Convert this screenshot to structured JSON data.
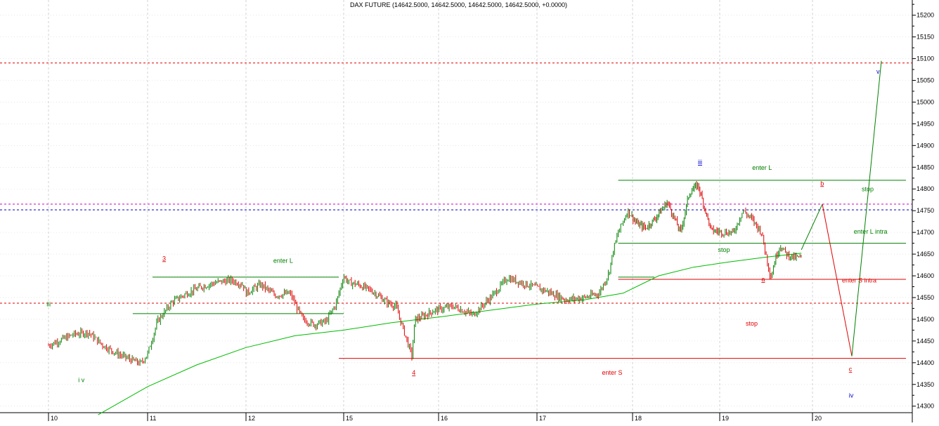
{
  "chart_data": {
    "type": "candlestick",
    "title": "DAX FUTURE (14642.5000, 14642.5000, 14642.5000, 14642.5000, +0.0000)",
    "instrument": "DAX FUTURE",
    "ohlc_last": {
      "open": 14642.5,
      "high": 14642.5,
      "low": 14642.5,
      "close": 14642.5,
      "change": 0.0
    },
    "x_tick_labels": [
      "10",
      "11",
      "12",
      "15",
      "16",
      "17",
      "18",
      "19",
      "20"
    ],
    "y_tick_labels": [
      "14300",
      "14350",
      "14400",
      "14450",
      "14500",
      "14550",
      "14600",
      "14650",
      "14700",
      "14750",
      "14800",
      "14850",
      "14900",
      "14950",
      "15000",
      "15050",
      "15100",
      "15150",
      "15200"
    ],
    "ylim": [
      14285,
      15235
    ],
    "up_color": "#008000",
    "down_color": "#e00000",
    "price_path_x": [
      0,
      0.25,
      0.4,
      0.55,
      0.7,
      0.85,
      0.93,
      1.0,
      1.1,
      1.25,
      1.4,
      1.55,
      1.7,
      1.85,
      1.97,
      2.0,
      2.15,
      2.3,
      2.45,
      2.58,
      2.7,
      2.82,
      2.92,
      3.0,
      3.05,
      3.15,
      3.3,
      3.45,
      3.55,
      3.72,
      3.75,
      3.82,
      3.95,
      4.15,
      4.35,
      4.55,
      4.7,
      4.9,
      5.1,
      5.3,
      5.5,
      5.65,
      5.75,
      5.8,
      5.85,
      5.95,
      6.05,
      6.15,
      6.25,
      6.4,
      6.55,
      6.65,
      6.75,
      6.9,
      7.05,
      7.15,
      7.25,
      7.35,
      7.45,
      7.55,
      7.6,
      7.65,
      7.72,
      7.8,
      7.88
    ],
    "price_path_y": [
      14440,
      14465,
      14470,
      14440,
      14420,
      14405,
      14398,
      14420,
      14495,
      14540,
      14560,
      14575,
      14585,
      14590,
      14580,
      14560,
      14580,
      14555,
      14560,
      14500,
      14488,
      14495,
      14535,
      14600,
      14585,
      14580,
      14565,
      14540,
      14530,
      14415,
      14500,
      14505,
      14520,
      14530,
      14510,
      14555,
      14595,
      14580,
      14565,
      14545,
      14550,
      14560,
      14605,
      14660,
      14700,
      14750,
      14720,
      14710,
      14730,
      14770,
      14700,
      14790,
      14810,
      14705,
      14700,
      14700,
      14750,
      14730,
      14700,
      14595,
      14640,
      14670,
      14650,
      14642,
      14642
    ],
    "moving_average_x": [
      0.5,
      1.0,
      1.5,
      2.0,
      2.5,
      3.0,
      3.5,
      4.0,
      4.5,
      5.0,
      5.5,
      5.9,
      6.3,
      6.7,
      7.1,
      7.5,
      7.88
    ],
    "moving_average_y": [
      14280,
      14345,
      14395,
      14435,
      14462,
      14475,
      14492,
      14505,
      14520,
      14535,
      14545,
      14560,
      14600,
      14620,
      14632,
      14643,
      14652
    ],
    "projection_x": [
      7.88,
      8.1,
      8.4,
      8.7
    ],
    "projection_y": [
      14660,
      14765,
      14415,
      15095
    ],
    "projection_color": "#008000",
    "projection_color_down": "#e00000",
    "hlines_full": [
      {
        "y": 15090,
        "color": "#e00000",
        "style": "dashed"
      },
      {
        "y": 14765,
        "color": "#cc00cc",
        "style": "dashed"
      },
      {
        "y": 14752,
        "color": "#0000cc",
        "style": "dashed"
      },
      {
        "y": 14537,
        "color": "#e00000",
        "style": "dashed"
      }
    ],
    "hlines_segments": [
      {
        "x1": 1.05,
        "x2": 2.95,
        "y": 14597,
        "color": "#008000"
      },
      {
        "x1": 0.85,
        "x2": 3.0,
        "y": 14513,
        "color": "#008000"
      },
      {
        "x1": 2.95,
        "x2": 8.95,
        "y": 14410,
        "color": "#e00000"
      },
      {
        "x1": 5.85,
        "x2": 8.95,
        "y": 14820,
        "color": "#008000"
      },
      {
        "x1": 5.85,
        "x2": 8.95,
        "y": 14675,
        "color": "#008000"
      },
      {
        "x1": 5.85,
        "x2": 8.95,
        "y": 14592,
        "color": "#e00000"
      },
      {
        "x1": 5.85,
        "x2": 6.25,
        "y": 14597,
        "color": "#008000"
      }
    ],
    "annotations": [
      {
        "text": "iii",
        "x": -0.02,
        "y": 14530,
        "color": "#008000"
      },
      {
        "text": "i v",
        "x": 0.3,
        "y": 14355,
        "color": "#008000"
      },
      {
        "text": "3",
        "x": 1.15,
        "y": 14635,
        "color": "#e00000",
        "underline": true
      },
      {
        "text": "enter L",
        "x": 2.28,
        "y": 14630,
        "color": "#008000"
      },
      {
        "text": "4",
        "x": 3.72,
        "y": 14372,
        "color": "#e00000",
        "underline": true
      },
      {
        "text": "enter S",
        "x": 5.68,
        "y": 14372,
        "color": "#e00000"
      },
      {
        "text": "iii",
        "x": 6.75,
        "y": 14857,
        "color": "#0000cc",
        "underline": true
      },
      {
        "text": "enter L",
        "x": 7.35,
        "y": 14844,
        "color": "#008000"
      },
      {
        "text": "b",
        "x": 8.08,
        "y": 14808,
        "color": "#e00000",
        "underline": true
      },
      {
        "text": "stop",
        "x": 8.5,
        "y": 14795,
        "color": "#008000"
      },
      {
        "text": "enter L intra",
        "x": 8.42,
        "y": 14697,
        "color": "#008000"
      },
      {
        "text": "stop",
        "x": 6.98,
        "y": 14655,
        "color": "#008000"
      },
      {
        "text": "a",
        "x": 7.45,
        "y": 14587,
        "color": "#e00000",
        "underline": true
      },
      {
        "text": "enter S intra",
        "x": 8.3,
        "y": 14585,
        "color": "#e00000"
      },
      {
        "text": "stop",
        "x": 7.28,
        "y": 14485,
        "color": "#e00000"
      },
      {
        "text": "c",
        "x": 8.37,
        "y": 14380,
        "color": "#e00000",
        "underline": true
      },
      {
        "text": "iv",
        "x": 8.37,
        "y": 14320,
        "color": "#0000cc"
      },
      {
        "text": "v",
        "x": 8.65,
        "y": 15065,
        "color": "#0000cc"
      }
    ],
    "grid": true,
    "legend": "none"
  }
}
